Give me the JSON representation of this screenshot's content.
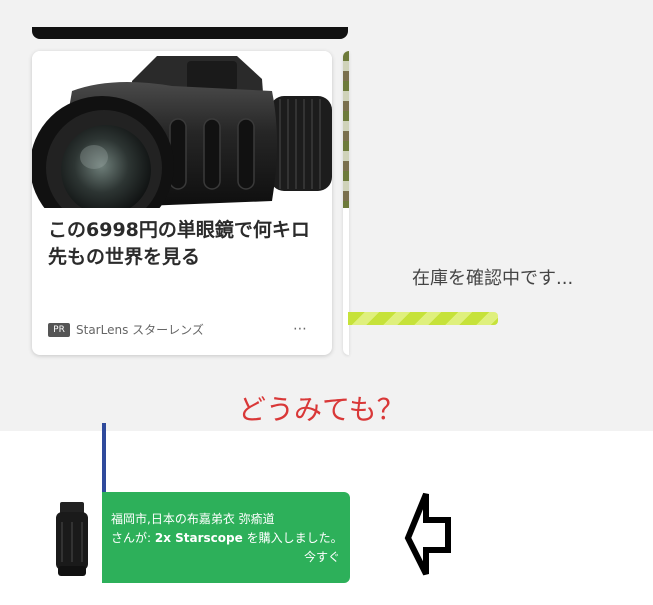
{
  "ad": {
    "title": "この6998円の単眼鏡で何キロ先もの世界を見る",
    "badge": "PR",
    "sponsor": "StarLens スターレンズ",
    "more": "⋯",
    "image_icon": "monocular-image"
  },
  "stock": {
    "text": "在庫を確認中です...",
    "bar_color": "#c6e23a"
  },
  "comment": {
    "text": "どうみても？",
    "color": "#d93838"
  },
  "notification": {
    "line1": "福岡市,日本の布嘉弟衣 弥瘉道",
    "line2_prefix": "さんが: ",
    "product": "2x Starscope",
    "line2_suffix": " を購入しました。",
    "time": "今すぐ",
    "color": "#2db05a"
  }
}
